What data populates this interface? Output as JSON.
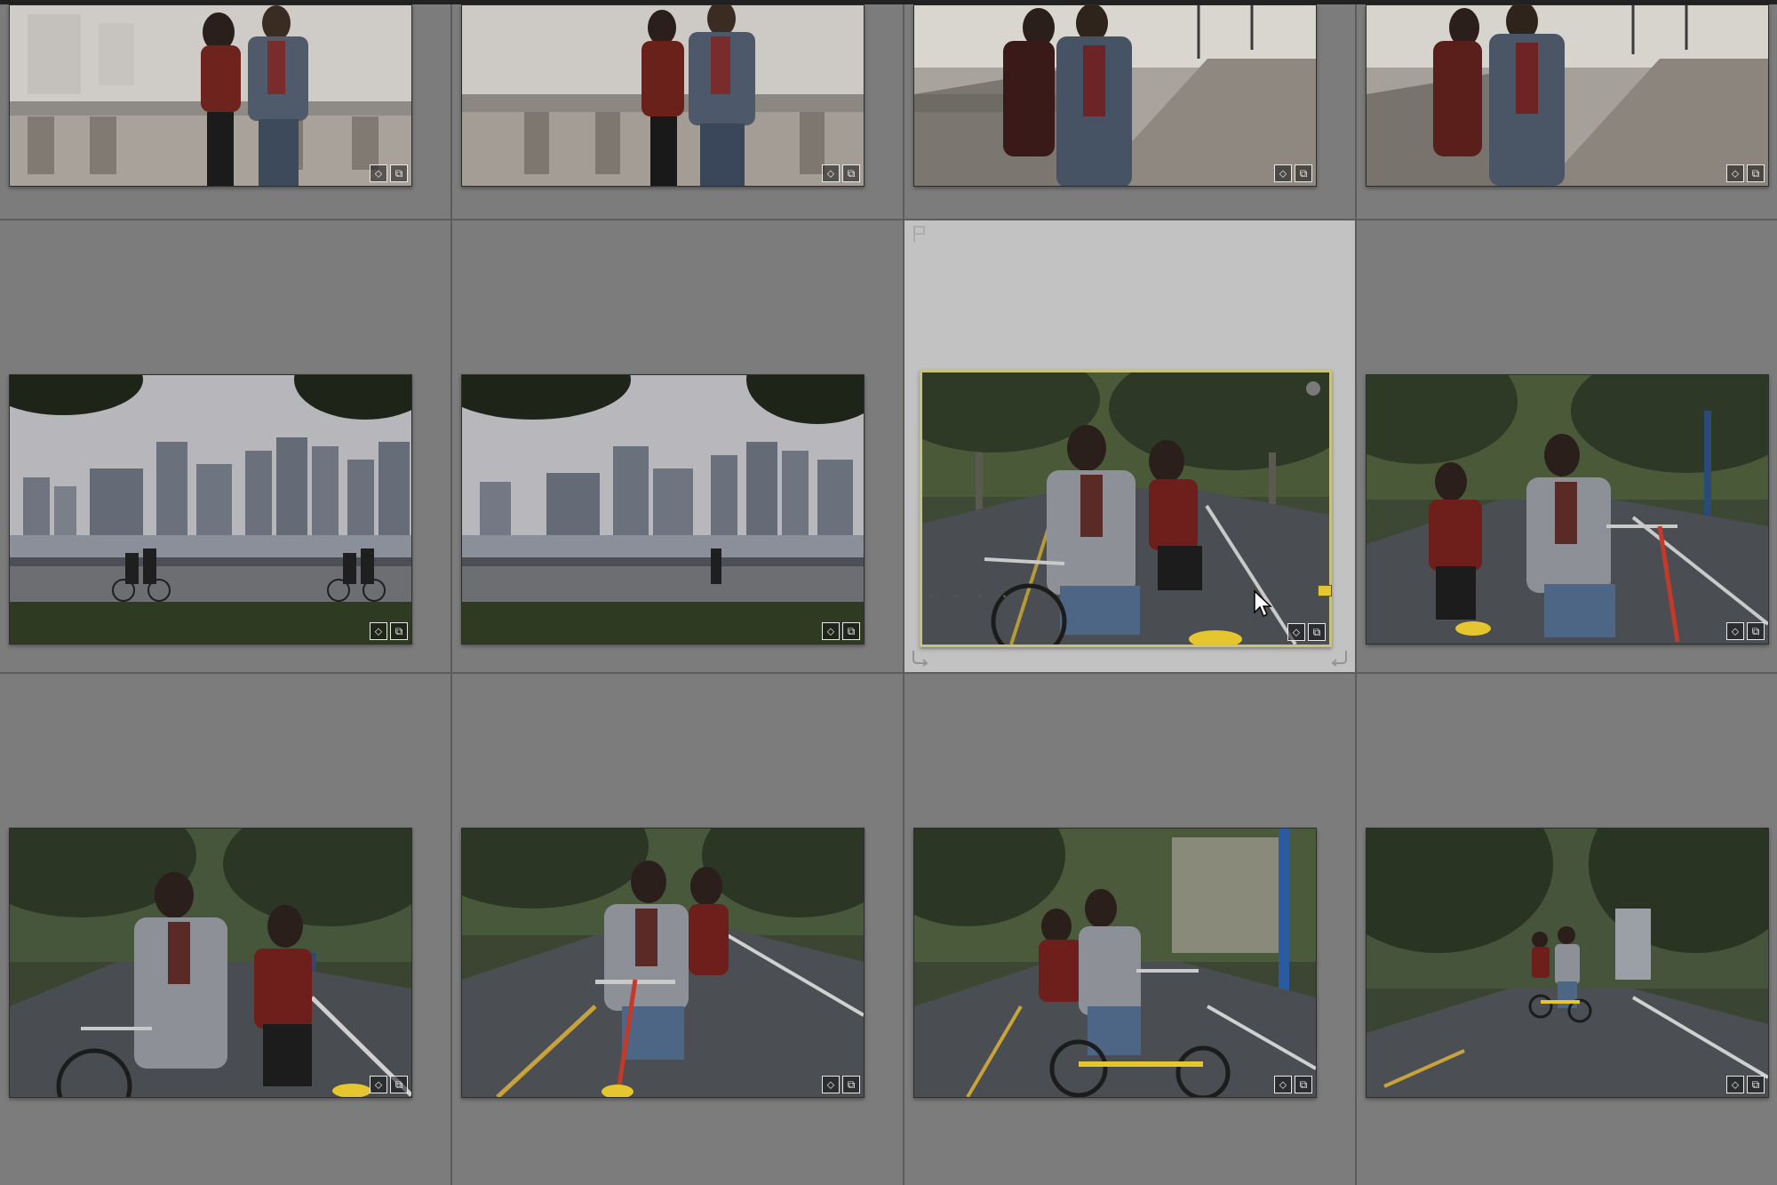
{
  "app": "Lightroom Library Grid",
  "grid": {
    "columns": 4,
    "rows": 3,
    "selected_index": 6,
    "cells": [
      {
        "scene": "couple-walking-railing-foggy",
        "badges": [
          "tag-icon",
          "virtual-copy-icon"
        ]
      },
      {
        "scene": "couple-walking-railing-foggy",
        "badges": [
          "tag-icon",
          "virtual-copy-icon"
        ]
      },
      {
        "scene": "couple-kissing-promenade",
        "badges": [
          "tag-icon",
          "virtual-copy-icon"
        ]
      },
      {
        "scene": "couple-promenade-smiling",
        "badges": [
          "tag-icon",
          "virtual-copy-icon"
        ]
      },
      {
        "scene": "city-skyline-cyclists",
        "badges": [
          "tag-icon",
          "virtual-copy-icon"
        ]
      },
      {
        "scene": "city-skyline-pedestrian",
        "badges": [
          "tag-icon",
          "virtual-copy-icon"
        ]
      },
      {
        "scene": "couple-tandem-bike-tree-road",
        "badges": [
          "tag-icon",
          "virtual-copy-icon"
        ],
        "rating": 0,
        "color_label": "yellow"
      },
      {
        "scene": "couple-tandem-bike-laughing",
        "badges": [
          "tag-icon",
          "virtual-copy-icon"
        ]
      },
      {
        "scene": "couple-tandem-bike-closeup",
        "badges": [
          "tag-icon",
          "virtual-copy-icon"
        ]
      },
      {
        "scene": "couple-tandem-bike-front",
        "badges": [
          "tag-icon",
          "virtual-copy-icon"
        ]
      },
      {
        "scene": "couple-tandem-bike-road-mid",
        "badges": [
          "tag-icon",
          "virtual-copy-icon"
        ]
      },
      {
        "scene": "couple-tandem-bike-distance",
        "badges": [
          "tag-icon",
          "virtual-copy-icon"
        ]
      }
    ]
  },
  "selected_cell": {
    "rating_dots": "• • • • •",
    "flag": "flag-icon",
    "rotate_left": "rotate-left-icon",
    "rotate_right": "rotate-right-icon",
    "color_label": "#e6c62e"
  }
}
